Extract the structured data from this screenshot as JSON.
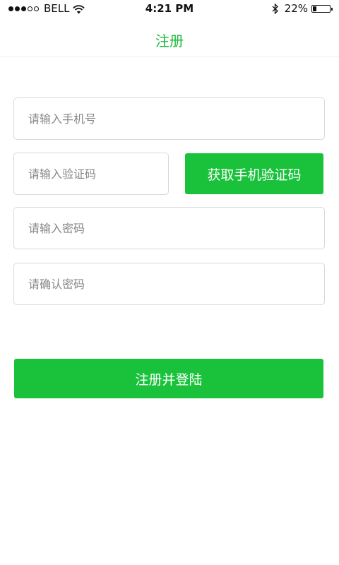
{
  "status_bar": {
    "carrier": "BELL",
    "time": "4:21 PM",
    "battery": "22%",
    "battery_level": 0.22
  },
  "nav": {
    "title": "注册"
  },
  "form": {
    "phone_placeholder": "请输入手机号",
    "code_placeholder": "请输入验证码",
    "get_code_label": "获取手机验证码",
    "password_placeholder": "请输入密码",
    "confirm_placeholder": "请确认密码",
    "submit_label": "注册并登陆"
  },
  "colors": {
    "accent": "#1ac23c",
    "title": "#1ab83a"
  }
}
